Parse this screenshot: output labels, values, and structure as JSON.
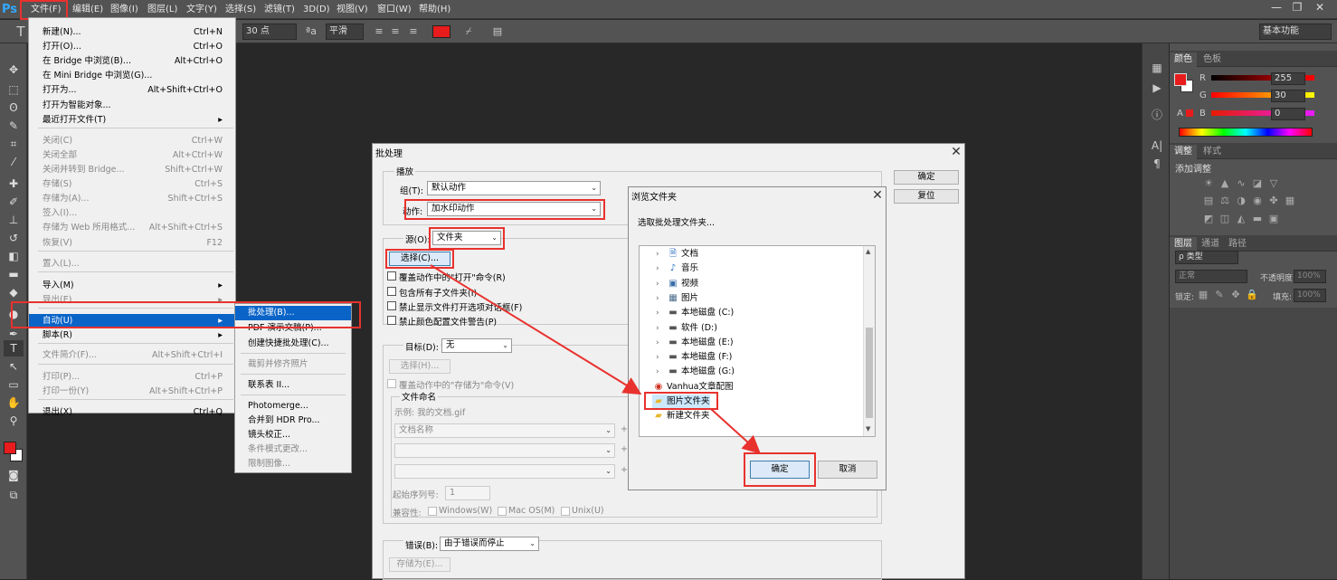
{
  "app": {
    "logo": "Ps"
  },
  "menubar": {
    "items": [
      "文件(F)",
      "编辑(E)",
      "图像(I)",
      "图层(L)",
      "文字(Y)",
      "选择(S)",
      "滤镜(T)",
      "3D(D)",
      "视图(V)",
      "窗口(W)",
      "帮助(H)"
    ],
    "window_buttons": [
      "—",
      "❐",
      "✕"
    ]
  },
  "optbar": {
    "tool": "T",
    "font_size": "30 点",
    "aa_icon": "ªa",
    "aa_mode": "平滑",
    "workspace": "基本功能"
  },
  "colors": {
    "accent_red": "#e8322e",
    "highlight_blue": "#0a64c8",
    "fg_color": "#e81c1c",
    "bg_color": "#ffffff"
  },
  "file_menu": {
    "items": [
      {
        "label": "新建(N)...",
        "shortcut": "Ctrl+N"
      },
      {
        "label": "打开(O)...",
        "shortcut": "Ctrl+O"
      },
      {
        "label": "在 Bridge 中浏览(B)...",
        "shortcut": "Alt+Ctrl+O"
      },
      {
        "label": "在 Mini Bridge 中浏览(G)...",
        "shortcut": ""
      },
      {
        "label": "打开为...",
        "shortcut": "Alt+Shift+Ctrl+O"
      },
      {
        "label": "打开为智能对象...",
        "shortcut": ""
      },
      {
        "label": "最近打开文件(T)",
        "shortcut": "▸"
      },
      {
        "label": "关闭(C)",
        "shortcut": "Ctrl+W"
      },
      {
        "label": "关闭全部",
        "shortcut": "Alt+Ctrl+W"
      },
      {
        "label": "关闭并转到 Bridge...",
        "shortcut": "Shift+Ctrl+W"
      },
      {
        "label": "存储(S)",
        "shortcut": "Ctrl+S"
      },
      {
        "label": "存储为(A)...",
        "shortcut": "Shift+Ctrl+S"
      },
      {
        "label": "签入(I)...",
        "shortcut": ""
      },
      {
        "label": "存储为 Web 所用格式...",
        "shortcut": "Alt+Shift+Ctrl+S"
      },
      {
        "label": "恢复(V)",
        "shortcut": "F12"
      },
      {
        "label": "置入(L)...",
        "shortcut": ""
      },
      {
        "label": "导入(M)",
        "shortcut": "▸"
      },
      {
        "label": "导出(E)",
        "shortcut": "▸"
      },
      {
        "label": "自动(U)",
        "shortcut": "▸"
      },
      {
        "label": "脚本(R)",
        "shortcut": "▸"
      },
      {
        "label": "文件简介(F)...",
        "shortcut": "Alt+Shift+Ctrl+I"
      },
      {
        "label": "打印(P)...",
        "shortcut": "Ctrl+P"
      },
      {
        "label": "打印一份(Y)",
        "shortcut": "Alt+Shift+Ctrl+P"
      },
      {
        "label": "退出(X)",
        "shortcut": "Ctrl+Q"
      }
    ]
  },
  "auto_submenu": {
    "items": [
      "批处理(B)...",
      "PDF 演示文稿(P)...",
      "创建快捷批处理(C)...",
      "裁剪并修齐照片",
      "联系表 II...",
      "Photomerge...",
      "合并到 HDR Pro...",
      "镜头校正...",
      "条件模式更改...",
      "限制图像..."
    ]
  },
  "batch_dialog": {
    "title": "批处理",
    "close": "✕",
    "ok": "确定",
    "reset": "复位",
    "play_group": "播放",
    "group_label": "组(T):",
    "group_value": "默认动作",
    "action_label": "动作:",
    "action_value": "加水印动作",
    "source_label": "源(O):",
    "source_value": "文件夹",
    "choose_btn": "选择(C)...",
    "checks": [
      "覆盖动作中的\"打开\"命令(R)",
      "包含所有子文件夹(I)",
      "禁止显示文件打开选项对话框(F)",
      "禁止颜色配置文件警告(P)"
    ],
    "dest_label": "目标(D):",
    "dest_value": "无",
    "dest_choose": "选择(H)...",
    "dest_check": "覆盖动作中的\"存储为\"命令(V)",
    "naming_group": "文件命名",
    "example": "示例: 我的文档.gif",
    "name_field1": "文档名称",
    "plus": "+",
    "start_serial_label": "起始序列号:",
    "start_serial_value": "1",
    "compat_label": "兼容性:",
    "compat": [
      "Windows(W)",
      "Mac OS(M)",
      "Unix(U)"
    ],
    "errors_label": "错误(B):",
    "errors_value": "由于错误而停止",
    "save_as_btn": "存储为(E)..."
  },
  "browse_dialog": {
    "title": "浏览文件夹",
    "close": "✕",
    "prompt": "选取批处理文件夹...",
    "tree": [
      {
        "label": "文档",
        "icon": "🗎"
      },
      {
        "label": "音乐",
        "icon": "♪"
      },
      {
        "label": "视频",
        "icon": "▣"
      },
      {
        "label": "图片",
        "icon": "▦"
      },
      {
        "label": "本地磁盘 (C:)",
        "icon": "▬"
      },
      {
        "label": "软件 (D:)",
        "icon": "▬"
      },
      {
        "label": "本地磁盘 (E:)",
        "icon": "▬"
      },
      {
        "label": "本地磁盘 (F:)",
        "icon": "▬"
      },
      {
        "label": "本地磁盘 (G:)",
        "icon": "▬"
      },
      {
        "label": "Vanhua文章配图",
        "icon": "◉"
      },
      {
        "label": "图片文件夹",
        "icon": "▰"
      },
      {
        "label": "新建文件夹",
        "icon": "▰"
      }
    ],
    "ok": "确定",
    "cancel": "取消"
  },
  "color_panel": {
    "tabs": [
      "颜色",
      "色板"
    ],
    "r_label": "R",
    "r_value": "255",
    "g_label": "G",
    "g_value": "30",
    "b_label": "B",
    "b_value": "0"
  },
  "adjust_panel": {
    "tabs": [
      "调整",
      "样式"
    ],
    "title": "添加调整"
  },
  "layers_panel": {
    "tabs": [
      "图层",
      "通道",
      "路径"
    ],
    "kind": "ρ 类型",
    "blend": "正常",
    "opacity_label": "不透明度:",
    "opacity_value": "100%",
    "lock_label": "锁定:",
    "fill_label": "填充:",
    "fill_value": "100%"
  }
}
